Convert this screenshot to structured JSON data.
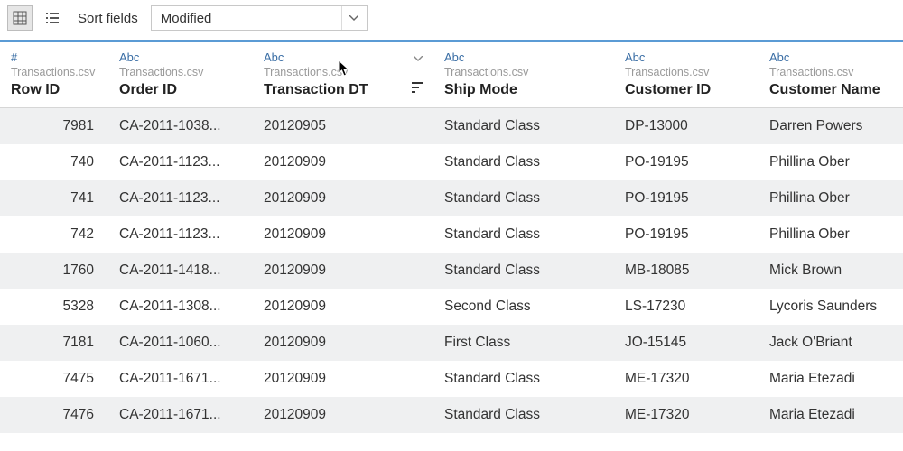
{
  "toolbar": {
    "sort_label": "Sort fields",
    "sort_value": "Modified"
  },
  "columns": [
    {
      "type_label": "#",
      "source": "Transactions.csv",
      "name": "Row ID",
      "numeric": true
    },
    {
      "type_label": "Abc",
      "source": "Transactions.csv",
      "name": "Order ID",
      "numeric": false
    },
    {
      "type_label": "Abc",
      "source": "Transactions.csv",
      "name": "Transaction DT",
      "numeric": false,
      "show_caret": true,
      "show_sort": true
    },
    {
      "type_label": "Abc",
      "source": "Transactions.csv",
      "name": "Ship Mode",
      "numeric": false
    },
    {
      "type_label": "Abc",
      "source": "Transactions.csv",
      "name": "Customer ID",
      "numeric": false
    },
    {
      "type_label": "Abc",
      "source": "Transactions.csv",
      "name": "Customer Name",
      "numeric": false
    }
  ],
  "rows": [
    {
      "row_id": "7981",
      "order_id": "CA-2011-1038...",
      "txn_dt": "20120905",
      "ship_mode": "Standard Class",
      "customer_id": "DP-13000",
      "customer_name": "Darren Powers"
    },
    {
      "row_id": "740",
      "order_id": "CA-2011-1123...",
      "txn_dt": "20120909",
      "ship_mode": "Standard Class",
      "customer_id": "PO-19195",
      "customer_name": "Phillina Ober"
    },
    {
      "row_id": "741",
      "order_id": "CA-2011-1123...",
      "txn_dt": "20120909",
      "ship_mode": "Standard Class",
      "customer_id": "PO-19195",
      "customer_name": "Phillina Ober"
    },
    {
      "row_id": "742",
      "order_id": "CA-2011-1123...",
      "txn_dt": "20120909",
      "ship_mode": "Standard Class",
      "customer_id": "PO-19195",
      "customer_name": "Phillina Ober"
    },
    {
      "row_id": "1760",
      "order_id": "CA-2011-1418...",
      "txn_dt": "20120909",
      "ship_mode": "Standard Class",
      "customer_id": "MB-18085",
      "customer_name": "Mick Brown"
    },
    {
      "row_id": "5328",
      "order_id": "CA-2011-1308...",
      "txn_dt": "20120909",
      "ship_mode": "Second Class",
      "customer_id": "LS-17230",
      "customer_name": "Lycoris Saunders"
    },
    {
      "row_id": "7181",
      "order_id": "CA-2011-1060...",
      "txn_dt": "20120909",
      "ship_mode": "First Class",
      "customer_id": "JO-15145",
      "customer_name": "Jack O'Briant"
    },
    {
      "row_id": "7475",
      "order_id": "CA-2011-1671...",
      "txn_dt": "20120909",
      "ship_mode": "Standard Class",
      "customer_id": "ME-17320",
      "customer_name": "Maria Etezadi"
    },
    {
      "row_id": "7476",
      "order_id": "CA-2011-1671...",
      "txn_dt": "20120909",
      "ship_mode": "Standard Class",
      "customer_id": "ME-17320",
      "customer_name": "Maria Etezadi"
    }
  ]
}
